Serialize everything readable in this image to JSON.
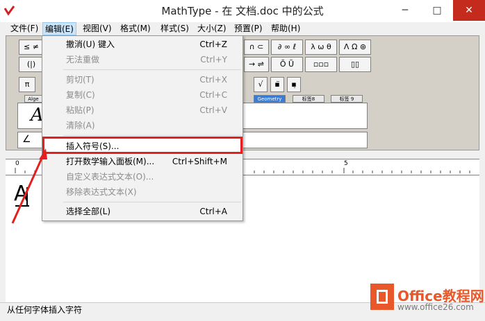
{
  "window": {
    "title": "MathType - 在 文档.doc 中的公式",
    "minimize_glyph": "─",
    "maximize_glyph": "□",
    "close_glyph": "✕"
  },
  "menubar": {
    "items": [
      "文件(F)",
      "编辑(E)",
      "视图(V)",
      "格式(M)",
      "样式(S)",
      "大小(Z)",
      "预置(P)",
      "帮助(H)"
    ]
  },
  "edit_menu": {
    "items": [
      {
        "label": "撤消(U) 键入",
        "shortcut": "Ctrl+Z",
        "enabled": true
      },
      {
        "label": "无法重做",
        "shortcut": "Ctrl+Y",
        "enabled": false
      },
      {
        "label": "剪切(T)",
        "shortcut": "Ctrl+X",
        "enabled": false
      },
      {
        "label": "复制(C)",
        "shortcut": "Ctrl+C",
        "enabled": false
      },
      {
        "label": "粘贴(P)",
        "shortcut": "Ctrl+V",
        "enabled": false
      },
      {
        "label": "清除(A)",
        "shortcut": "",
        "enabled": false
      },
      {
        "label": "插入符号(S)...",
        "shortcut": "",
        "enabled": true
      },
      {
        "label": "打开数学输入面板(M)...",
        "shortcut": "Ctrl+Shift+M",
        "enabled": true
      },
      {
        "label": "自定义表达式文本(O)...",
        "shortcut": "",
        "enabled": false
      },
      {
        "label": "移除表达式文本(X)",
        "shortcut": "",
        "enabled": false
      },
      {
        "label": "选择全部(L)",
        "shortcut": "Ctrl+A",
        "enabled": true
      }
    ]
  },
  "toolbar": {
    "row1_left": [
      "≤ ≠",
      "(|)",
      "π"
    ],
    "row1_right": [
      "∩ ⊂",
      "∂ ∞ ℓ",
      "λ ω θ",
      "Λ Ω ⊛"
    ],
    "row2_right": [
      "→ ⇌",
      "Ō Ũ",
      "▫▫▫",
      "▯▯"
    ],
    "row3_right": [
      "√",
      "▪̈",
      "▪̣"
    ],
    "tabs": [
      "Alge",
      "Geometry",
      "标签8",
      "标签 9"
    ],
    "template_preview": "A"
  },
  "ruler": {
    "marks": [
      "0",
      "5"
    ]
  },
  "editor": {
    "content": "A"
  },
  "status": {
    "text": "从任何字体插入字符"
  },
  "watermark": {
    "brand": "Office教程网",
    "url": "www.office26.com"
  },
  "colors": {
    "highlight_box": "#e41f1f",
    "menu_hover": "#cce4f7",
    "close_button": "#c42b1c",
    "logo": "#e8582a"
  }
}
